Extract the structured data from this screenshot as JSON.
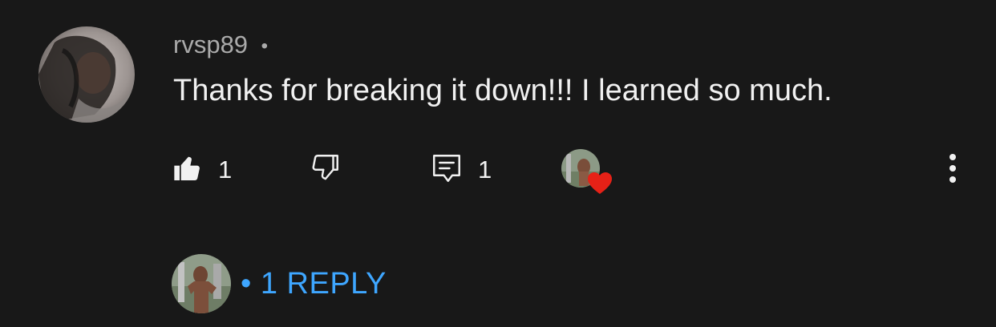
{
  "comment": {
    "author": "rvsp89",
    "separator": "•",
    "text": "Thanks for breaking it down!!! I learned so much."
  },
  "actions": {
    "like_count": "1",
    "reply_count": "1"
  },
  "replies": {
    "label": "• 1 REPLY"
  },
  "colors": {
    "background": "#181818",
    "text": "#f1f1f1",
    "meta": "#aaaaaa",
    "link": "#3ea6ff",
    "heart": "#e62117"
  },
  "icons": {
    "like": "thumbs-up-icon",
    "dislike": "thumbs-down-icon",
    "reply": "comment-icon",
    "heart": "creator-heart-icon",
    "more": "more-vertical-icon"
  }
}
